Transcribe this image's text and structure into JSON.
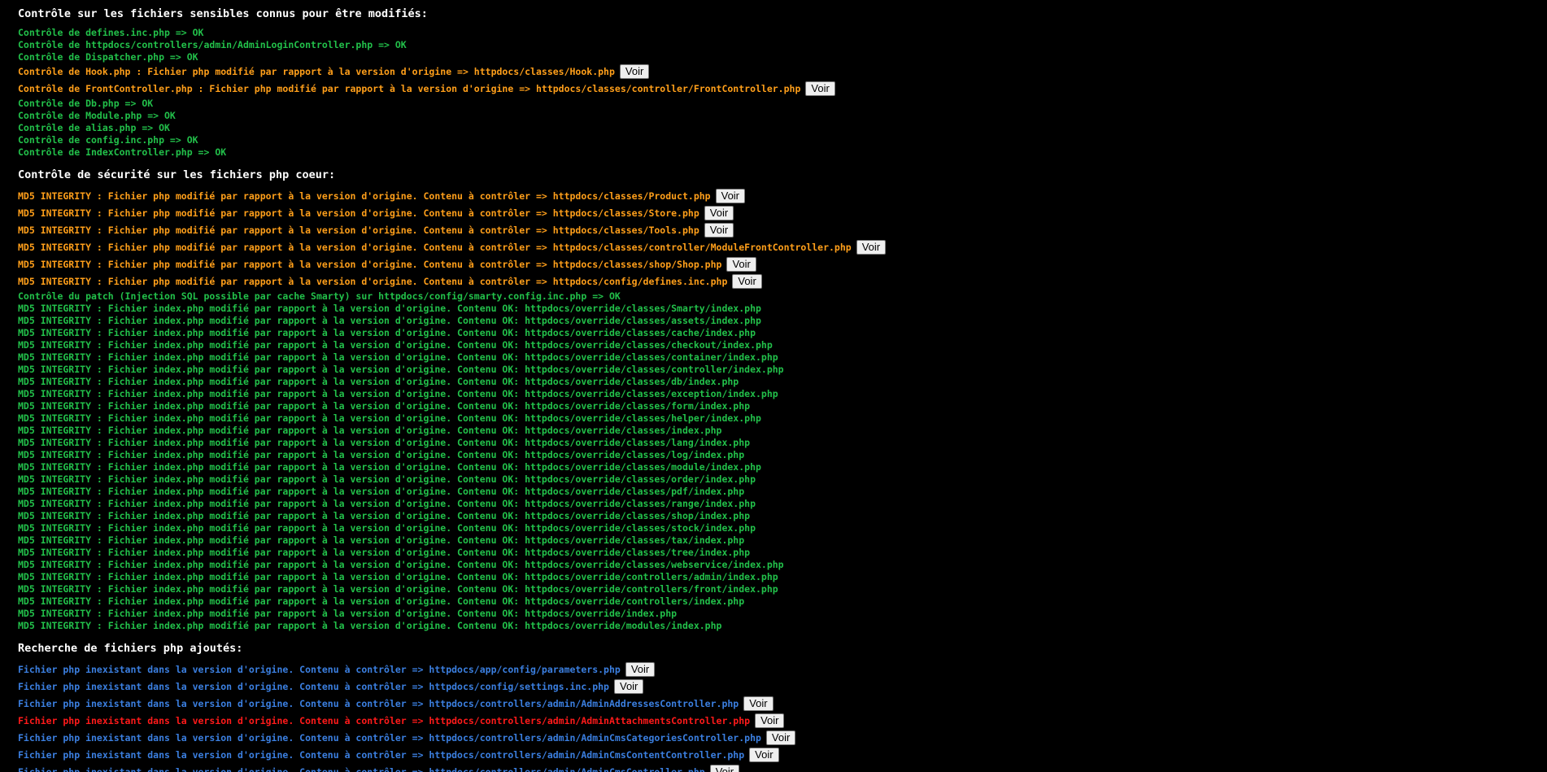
{
  "colors": {
    "background": "#000000",
    "heading": "#ffffff",
    "ok": "#22c04a",
    "warning": "#ff9f1a",
    "info": "#3b7fe0",
    "danger": "#ff1a1a",
    "button_bg": "#efefef"
  },
  "button_label": "Voir",
  "sections": [
    {
      "title": "Contrôle sur les fichiers sensibles connus pour être modifiés:",
      "lines": [
        {
          "text": "Contrôle de defines.inc.php => OK",
          "color": "green",
          "button": false
        },
        {
          "text": "Contrôle de httpdocs/controllers/admin/AdminLoginController.php => OK",
          "color": "green",
          "button": false
        },
        {
          "text": "Contrôle de Dispatcher.php => OK",
          "color": "green",
          "button": false
        },
        {
          "text": "Contrôle de Hook.php : Fichier php modifié par rapport à la version d'origine => httpdocs/classes/Hook.php",
          "color": "orange",
          "button": true
        },
        {
          "text": "Contrôle de FrontController.php : Fichier php modifié par rapport à la version d'origine => httpdocs/classes/controller/FrontController.php",
          "color": "orange",
          "button": true
        },
        {
          "text": "Contrôle de Db.php => OK",
          "color": "green",
          "button": false
        },
        {
          "text": "Contrôle de Module.php => OK",
          "color": "green",
          "button": false
        },
        {
          "text": "Contrôle de alias.php => OK",
          "color": "green",
          "button": false
        },
        {
          "text": "Contrôle de config.inc.php => OK",
          "color": "green",
          "button": false
        },
        {
          "text": "Contrôle de IndexController.php => OK",
          "color": "green",
          "button": false
        }
      ]
    },
    {
      "title": "Contrôle de sécurité sur les fichiers php coeur:",
      "lines": [
        {
          "text": "MD5 INTEGRITY : Fichier php modifié par rapport à la version d'origine. Contenu à contrôler => httpdocs/classes/Product.php",
          "color": "orange",
          "button": true
        },
        {
          "text": "MD5 INTEGRITY : Fichier php modifié par rapport à la version d'origine. Contenu à contrôler => httpdocs/classes/Store.php",
          "color": "orange",
          "button": true
        },
        {
          "text": "MD5 INTEGRITY : Fichier php modifié par rapport à la version d'origine. Contenu à contrôler => httpdocs/classes/Tools.php",
          "color": "orange",
          "button": true
        },
        {
          "text": "MD5 INTEGRITY : Fichier php modifié par rapport à la version d'origine. Contenu à contrôler => httpdocs/classes/controller/ModuleFrontController.php",
          "color": "orange",
          "button": true
        },
        {
          "text": "MD5 INTEGRITY : Fichier php modifié par rapport à la version d'origine. Contenu à contrôler => httpdocs/classes/shop/Shop.php",
          "color": "orange",
          "button": true
        },
        {
          "text": "MD5 INTEGRITY : Fichier php modifié par rapport à la version d'origine. Contenu à contrôler => httpdocs/config/defines.inc.php",
          "color": "orange",
          "button": true
        },
        {
          "text": "Contrôle du patch (Injection SQL possible par cache Smarty) sur httpdocs/config/smarty.config.inc.php => OK",
          "color": "green",
          "button": false
        },
        {
          "text": "MD5 INTEGRITY : Fichier index.php modifié par rapport à la version d'origine. Contenu OK: httpdocs/override/classes/Smarty/index.php",
          "color": "green",
          "button": false
        },
        {
          "text": "MD5 INTEGRITY : Fichier index.php modifié par rapport à la version d'origine. Contenu OK: httpdocs/override/classes/assets/index.php",
          "color": "green",
          "button": false
        },
        {
          "text": "MD5 INTEGRITY : Fichier index.php modifié par rapport à la version d'origine. Contenu OK: httpdocs/override/classes/cache/index.php",
          "color": "green",
          "button": false
        },
        {
          "text": "MD5 INTEGRITY : Fichier index.php modifié par rapport à la version d'origine. Contenu OK: httpdocs/override/classes/checkout/index.php",
          "color": "green",
          "button": false
        },
        {
          "text": "MD5 INTEGRITY : Fichier index.php modifié par rapport à la version d'origine. Contenu OK: httpdocs/override/classes/container/index.php",
          "color": "green",
          "button": false
        },
        {
          "text": "MD5 INTEGRITY : Fichier index.php modifié par rapport à la version d'origine. Contenu OK: httpdocs/override/classes/controller/index.php",
          "color": "green",
          "button": false
        },
        {
          "text": "MD5 INTEGRITY : Fichier index.php modifié par rapport à la version d'origine. Contenu OK: httpdocs/override/classes/db/index.php",
          "color": "green",
          "button": false
        },
        {
          "text": "MD5 INTEGRITY : Fichier index.php modifié par rapport à la version d'origine. Contenu OK: httpdocs/override/classes/exception/index.php",
          "color": "green",
          "button": false
        },
        {
          "text": "MD5 INTEGRITY : Fichier index.php modifié par rapport à la version d'origine. Contenu OK: httpdocs/override/classes/form/index.php",
          "color": "green",
          "button": false
        },
        {
          "text": "MD5 INTEGRITY : Fichier index.php modifié par rapport à la version d'origine. Contenu OK: httpdocs/override/classes/helper/index.php",
          "color": "green",
          "button": false
        },
        {
          "text": "MD5 INTEGRITY : Fichier index.php modifié par rapport à la version d'origine. Contenu OK: httpdocs/override/classes/index.php",
          "color": "green",
          "button": false
        },
        {
          "text": "MD5 INTEGRITY : Fichier index.php modifié par rapport à la version d'origine. Contenu OK: httpdocs/override/classes/lang/index.php",
          "color": "green",
          "button": false
        },
        {
          "text": "MD5 INTEGRITY : Fichier index.php modifié par rapport à la version d'origine. Contenu OK: httpdocs/override/classes/log/index.php",
          "color": "green",
          "button": false
        },
        {
          "text": "MD5 INTEGRITY : Fichier index.php modifié par rapport à la version d'origine. Contenu OK: httpdocs/override/classes/module/index.php",
          "color": "green",
          "button": false
        },
        {
          "text": "MD5 INTEGRITY : Fichier index.php modifié par rapport à la version d'origine. Contenu OK: httpdocs/override/classes/order/index.php",
          "color": "green",
          "button": false
        },
        {
          "text": "MD5 INTEGRITY : Fichier index.php modifié par rapport à la version d'origine. Contenu OK: httpdocs/override/classes/pdf/index.php",
          "color": "green",
          "button": false
        },
        {
          "text": "MD5 INTEGRITY : Fichier index.php modifié par rapport à la version d'origine. Contenu OK: httpdocs/override/classes/range/index.php",
          "color": "green",
          "button": false
        },
        {
          "text": "MD5 INTEGRITY : Fichier index.php modifié par rapport à la version d'origine. Contenu OK: httpdocs/override/classes/shop/index.php",
          "color": "green",
          "button": false
        },
        {
          "text": "MD5 INTEGRITY : Fichier index.php modifié par rapport à la version d'origine. Contenu OK: httpdocs/override/classes/stock/index.php",
          "color": "green",
          "button": false
        },
        {
          "text": "MD5 INTEGRITY : Fichier index.php modifié par rapport à la version d'origine. Contenu OK: httpdocs/override/classes/tax/index.php",
          "color": "green",
          "button": false
        },
        {
          "text": "MD5 INTEGRITY : Fichier index.php modifié par rapport à la version d'origine. Contenu OK: httpdocs/override/classes/tree/index.php",
          "color": "green",
          "button": false
        },
        {
          "text": "MD5 INTEGRITY : Fichier index.php modifié par rapport à la version d'origine. Contenu OK: httpdocs/override/classes/webservice/index.php",
          "color": "green",
          "button": false
        },
        {
          "text": "MD5 INTEGRITY : Fichier index.php modifié par rapport à la version d'origine. Contenu OK: httpdocs/override/controllers/admin/index.php",
          "color": "green",
          "button": false
        },
        {
          "text": "MD5 INTEGRITY : Fichier index.php modifié par rapport à la version d'origine. Contenu OK: httpdocs/override/controllers/front/index.php",
          "color": "green",
          "button": false
        },
        {
          "text": "MD5 INTEGRITY : Fichier index.php modifié par rapport à la version d'origine. Contenu OK: httpdocs/override/controllers/index.php",
          "color": "green",
          "button": false
        },
        {
          "text": "MD5 INTEGRITY : Fichier index.php modifié par rapport à la version d'origine. Contenu OK: httpdocs/override/index.php",
          "color": "green",
          "button": false
        },
        {
          "text": "MD5 INTEGRITY : Fichier index.php modifié par rapport à la version d'origine. Contenu OK: httpdocs/override/modules/index.php",
          "color": "green",
          "button": false
        }
      ]
    },
    {
      "title": "Recherche de fichiers php ajoutés:",
      "lines": [
        {
          "text": "Fichier php inexistant dans la version d'origine. Contenu à contrôler => httpdocs/app/config/parameters.php",
          "color": "blue",
          "button": true
        },
        {
          "text": "Fichier php inexistant dans la version d'origine. Contenu à contrôler => httpdocs/config/settings.inc.php",
          "color": "blue",
          "button": true
        },
        {
          "text": "Fichier php inexistant dans la version d'origine. Contenu à contrôler => httpdocs/controllers/admin/AdminAddressesController.php",
          "color": "blue",
          "button": true
        },
        {
          "text": "Fichier php inexistant dans la version d'origine. Contenu à contrôler => httpdocs/controllers/admin/AdminAttachmentsController.php",
          "color": "red",
          "button": true
        },
        {
          "text": "Fichier php inexistant dans la version d'origine. Contenu à contrôler => httpdocs/controllers/admin/AdminCmsCategoriesController.php",
          "color": "blue",
          "button": true
        },
        {
          "text": "Fichier php inexistant dans la version d'origine. Contenu à contrôler => httpdocs/controllers/admin/AdminCmsContentController.php",
          "color": "blue",
          "button": true
        },
        {
          "text": "Fichier php inexistant dans la version d'origine. Contenu à contrôler => httpdocs/controllers/admin/AdminCmsController.php",
          "color": "blue",
          "button": true
        }
      ]
    }
  ]
}
